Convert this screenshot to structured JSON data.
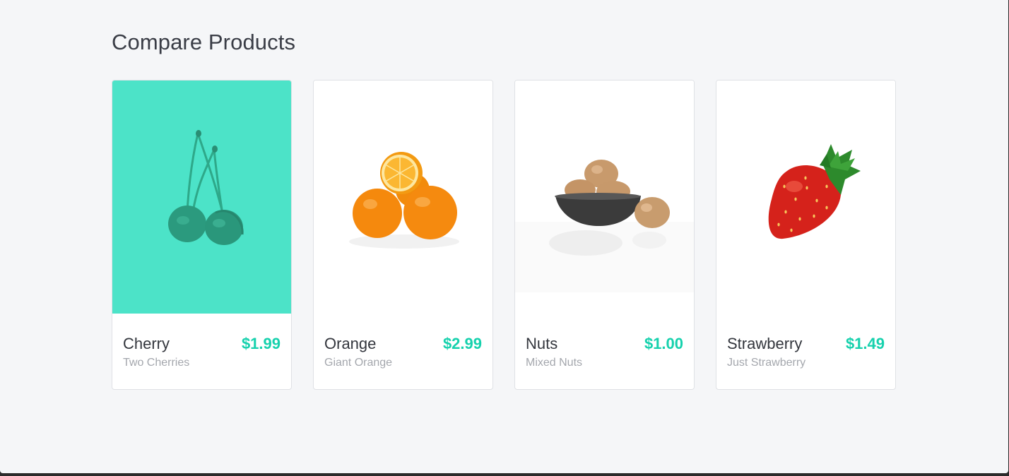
{
  "page": {
    "title": "Compare Products"
  },
  "products": [
    {
      "name": "Cherry",
      "description": "Two Cherries",
      "price": "$1.99",
      "icon": "cherry-image",
      "selected": true,
      "highlight_color": "#4ce3c8"
    },
    {
      "name": "Orange",
      "description": "Giant Orange",
      "price": "$2.99",
      "icon": "orange-image",
      "selected": false
    },
    {
      "name": "Nuts",
      "description": "Mixed Nuts",
      "price": "$1.00",
      "icon": "nuts-image",
      "selected": false
    },
    {
      "name": "Strawberry",
      "description": "Just Strawberry",
      "price": "$1.49",
      "icon": "strawberry-image",
      "selected": false
    }
  ],
  "colors": {
    "accent": "#16d1ad",
    "page_background": "#f5f6f8",
    "title_text": "#3a3d46",
    "subtext": "#a4a7ad"
  }
}
